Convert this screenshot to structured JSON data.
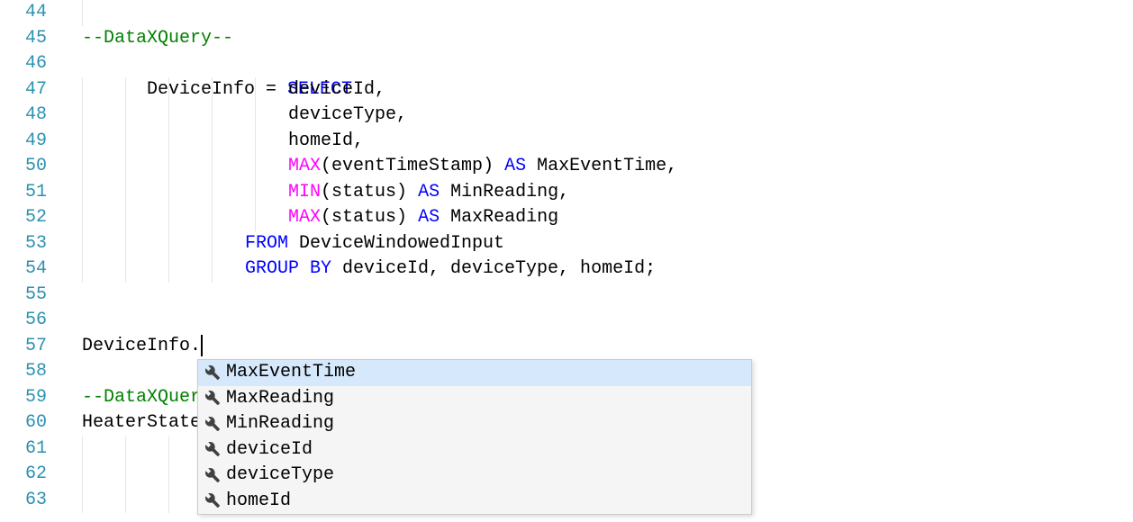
{
  "gutter": {
    "l44": "44",
    "l45": "45",
    "l46": "46",
    "l47": "47",
    "l48": "48",
    "l49": "49",
    "l50": "50",
    "l51": "51",
    "l52": "52",
    "l53": "53",
    "l54": "54",
    "l55": "55",
    "l56": "56",
    "l57": "57",
    "l58": "58",
    "l59": "59",
    "l60": "60",
    "l61": "61",
    "l62": "62",
    "l63": "63"
  },
  "code": {
    "l45": {
      "comment": "--DataXQuery--"
    },
    "l46": {
      "a": "DeviceInfo = ",
      "kw": "SELECT"
    },
    "l47": {
      "a": "deviceId,"
    },
    "l48": {
      "a": "deviceType,"
    },
    "l49": {
      "a": "homeId,"
    },
    "l50": {
      "fn": "MAX",
      "paren_open": "(",
      "arg": "eventTimeStamp",
      "paren_close": ")",
      "as": " AS ",
      "alias": "MaxEventTime,"
    },
    "l51": {
      "fn": "MIN",
      "paren_open": "(",
      "arg": "status",
      "paren_close": ")",
      "as": " AS ",
      "alias": "MinReading,"
    },
    "l52": {
      "fn": "MAX",
      "paren_open": "(",
      "arg": "status",
      "paren_close": ")",
      "as": " AS ",
      "alias": "MaxReading"
    },
    "l53": {
      "kw": "FROM",
      "a": " DeviceWindowedInput"
    },
    "l54": {
      "kw": "GROUP BY",
      "a": " deviceId, deviceType, homeId;"
    },
    "l57": {
      "a": "DeviceInfo."
    },
    "l59": {
      "comment": "--DataXQuer"
    },
    "l60": {
      "a": "HeaterState"
    }
  },
  "suggest": {
    "i0": "MaxEventTime",
    "i1": "MaxReading",
    "i2": "MinReading",
    "i3": "deviceId",
    "i4": "deviceType",
    "i5": "homeId"
  }
}
